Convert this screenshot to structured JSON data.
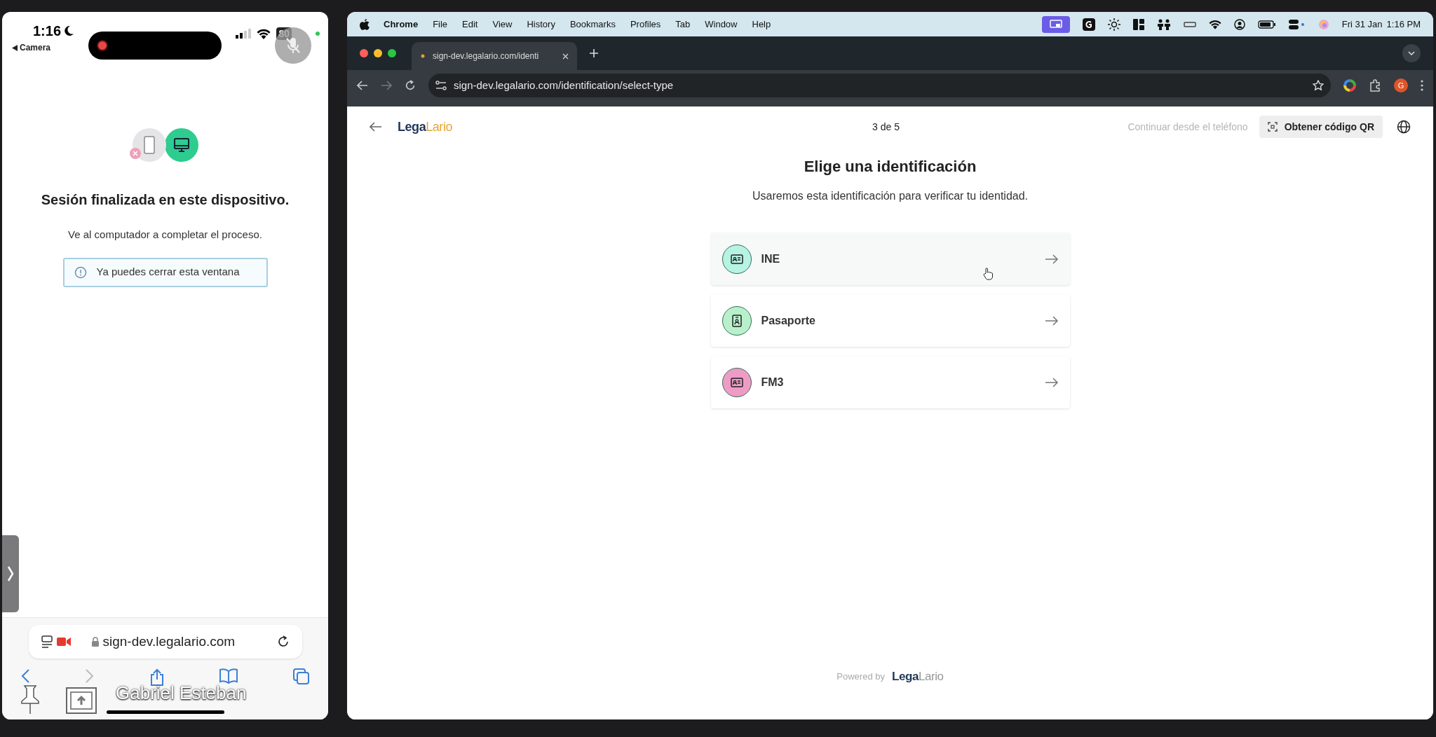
{
  "phone": {
    "status_bar": {
      "time": "1:16",
      "back_app": "Camera",
      "battery": "80"
    },
    "title": "Sesión finalizada en este dispositivo.",
    "message": "Ve al computador a completar el proceso.",
    "notice": "Ya puedes cerrar esta ventana",
    "address": "sign-dev.legalario.com"
  },
  "call_overlay": {
    "participant": "Gabriel Esteban"
  },
  "menu_bar": {
    "app": "Chrome",
    "items": [
      "File",
      "Edit",
      "View",
      "History",
      "Bookmarks",
      "Profiles",
      "Tab",
      "Window",
      "Help"
    ],
    "date": "Fri 31 Jan",
    "time": "1:16 PM"
  },
  "browser": {
    "tabs": [
      {
        "title": "sign-dev.legalario.com/identi",
        "selected": true
      }
    ],
    "url": "sign-dev.legalario.com/identification/select-type",
    "profile_initial": "G"
  },
  "page": {
    "logo": {
      "first": "Lega",
      "second": "Lario"
    },
    "step": "3 de 5",
    "continue_on_phone": {
      "label": "Continuar desde el teléfono",
      "disabled": true
    },
    "qr_button": "Obtener código QR",
    "title": "Elige una identificación",
    "subtitle": "Usaremos esta identificación para verificar tu identidad.",
    "options": [
      {
        "label": "INE",
        "kind": "card",
        "color": "#b6f3e2",
        "hovered": true
      },
      {
        "label": "Pasaporte",
        "kind": "passport",
        "color": "#b8f0cb",
        "hovered": false
      },
      {
        "label": "FM3",
        "kind": "card",
        "color": "#ee9cc6",
        "hovered": false
      }
    ],
    "footer": {
      "powered_by": "Powered by",
      "logo": {
        "first": "Lega",
        "second": "Lario"
      }
    }
  }
}
